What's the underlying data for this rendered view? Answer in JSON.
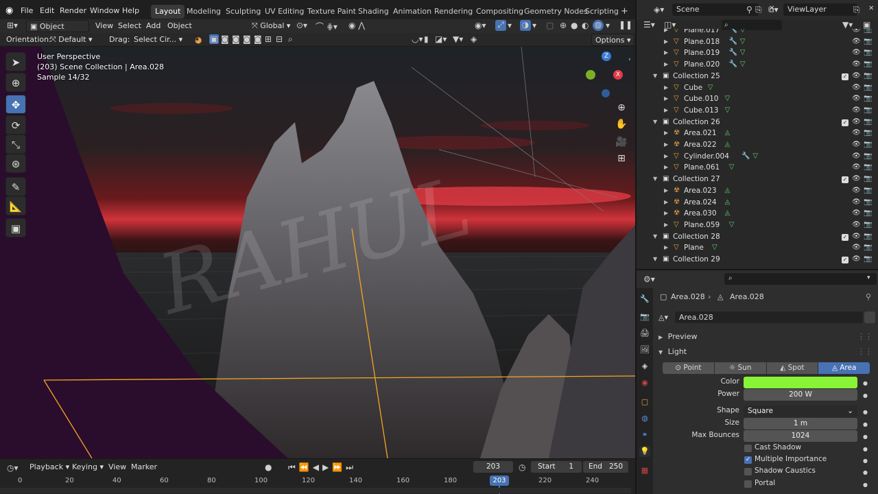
{
  "menubar": {
    "menus": [
      "File",
      "Edit",
      "Render",
      "Window",
      "Help"
    ],
    "workspaces": [
      "Layout",
      "Modeling",
      "Sculpting",
      "UV Editing",
      "Texture Paint",
      "Shading",
      "Animation",
      "Rendering",
      "Compositing",
      "Geometry Nodes",
      "Scripting"
    ],
    "active_workspace": "Layout",
    "add_tab": "+",
    "scene": "Scene",
    "view_layer": "ViewLayer"
  },
  "viewport_header": {
    "mode": "Object Mode",
    "menus": [
      "View",
      "Select",
      "Add",
      "Object"
    ],
    "transform_orientation": "Global"
  },
  "tool_header": {
    "orientation_label": "Orientation:",
    "orientation_value": "Default",
    "drag_label": "Drag:",
    "drag_value": "Select Cir...",
    "options": "Options"
  },
  "viewport": {
    "perspective": "User Perspective",
    "collection_info": "(203) Scene Collection | Area.028",
    "sample": "Sample 14/32",
    "watermark": "RAHUL",
    "gizmo": {
      "z": "Z",
      "x": "X"
    }
  },
  "timeline": {
    "menus": [
      "Playback",
      "Keying",
      "View",
      "Marker"
    ],
    "current_frame": "203",
    "start_label": "Start",
    "start": "1",
    "end_label": "End",
    "end": "250",
    "ticks": [
      "0",
      "20",
      "40",
      "60",
      "80",
      "100",
      "120",
      "140",
      "160",
      "180",
      "200",
      "220",
      "240"
    ],
    "playhead": "203"
  },
  "outliner": {
    "rows": [
      {
        "name": "Plane.017",
        "type": "mesh",
        "indent": 1,
        "extra": "mod"
      },
      {
        "name": "Plane.018",
        "type": "mesh",
        "indent": 1,
        "extra": "mod"
      },
      {
        "name": "Plane.019",
        "type": "mesh",
        "indent": 1,
        "extra": "mod"
      },
      {
        "name": "Plane.020",
        "type": "mesh",
        "indent": 1,
        "extra": "mod"
      },
      {
        "name": "Collection 25",
        "type": "collection",
        "indent": 0
      },
      {
        "name": "Cube",
        "type": "mesh",
        "indent": 1,
        "extra": ""
      },
      {
        "name": "Cube.010",
        "type": "mesh",
        "indent": 1,
        "extra": ""
      },
      {
        "name": "Cube.013",
        "type": "mesh",
        "indent": 1,
        "extra": ""
      },
      {
        "name": "Collection 26",
        "type": "collection",
        "indent": 0
      },
      {
        "name": "Area.021",
        "type": "light",
        "indent": 1,
        "extra": ""
      },
      {
        "name": "Area.022",
        "type": "light",
        "indent": 1,
        "extra": ""
      },
      {
        "name": "Cylinder.004",
        "type": "mesh",
        "indent": 1,
        "extra": "mod"
      },
      {
        "name": "Plane.061",
        "type": "mesh",
        "indent": 1,
        "extra": ""
      },
      {
        "name": "Collection 27",
        "type": "collection",
        "indent": 0
      },
      {
        "name": "Area.023",
        "type": "light",
        "indent": 1,
        "extra": ""
      },
      {
        "name": "Area.024",
        "type": "light",
        "indent": 1,
        "extra": ""
      },
      {
        "name": "Area.030",
        "type": "light",
        "indent": 1,
        "extra": ""
      },
      {
        "name": "Plane.059",
        "type": "mesh",
        "indent": 1,
        "extra": ""
      },
      {
        "name": "Collection 28",
        "type": "collection",
        "indent": 0
      },
      {
        "name": "Plane",
        "type": "mesh",
        "indent": 1,
        "extra": ""
      },
      {
        "name": "Collection 29",
        "type": "collection",
        "indent": 0
      }
    ]
  },
  "properties": {
    "breadcrumb_object": "Area.028",
    "breadcrumb_data": "Area.028",
    "datablock_name": "Area.028",
    "preview_panel": "Preview",
    "light_panel": "Light",
    "light_types": [
      "Point",
      "Sun",
      "Spot",
      "Area"
    ],
    "active_light_type": "Area",
    "color_label": "Color",
    "color_value": "#89f337",
    "power_label": "Power",
    "power_value": "200 W",
    "shape_label": "Shape",
    "shape_value": "Square",
    "size_label": "Size",
    "size_value": "1 m",
    "max_bounces_label": "Max Bounces",
    "max_bounces_value": "1024",
    "checkboxes": [
      {
        "label": "Cast Shadow",
        "checked": false
      },
      {
        "label": "Multiple Importance",
        "checked": true
      },
      {
        "label": "Shadow Caustics",
        "checked": false
      },
      {
        "label": "Portal",
        "checked": false
      }
    ]
  }
}
